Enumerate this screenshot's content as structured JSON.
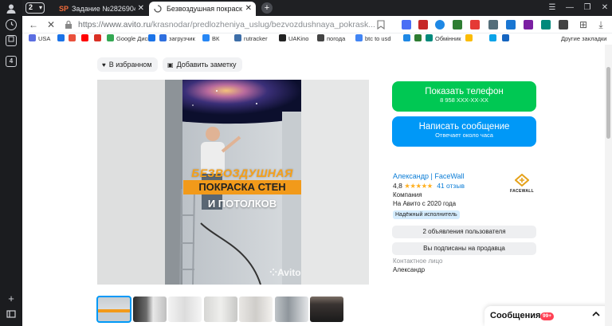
{
  "sidepanel": {
    "tab_count": "2",
    "shortcut_label": "4"
  },
  "tabs": [
    {
      "favicon": "SP",
      "title": "Задание №2826904 - пров"
    },
    {
      "favicon": "loading-icon",
      "title": "Безвоздушная покраск"
    }
  ],
  "address_bar": {
    "url_host": "https://www.avito.ru",
    "url_path": "/krasnodar/predlozheniya_uslug/bezvozdushnaya_pokrask..."
  },
  "bookmarks": [
    {
      "label": "USA",
      "color": "#5b6ee1"
    },
    {
      "label": "",
      "color": "#1a73e8"
    },
    {
      "label": "",
      "color": "#e9503c"
    },
    {
      "label": "",
      "color": "#ff0000"
    },
    {
      "label": "",
      "color": "#d93025"
    },
    {
      "label": "Google Диск",
      "color": "#34a853"
    },
    {
      "label": "",
      "color": "#1a73e8"
    },
    {
      "label": "загрузчик",
      "color": "#2f6fdf"
    },
    {
      "label": "ВК",
      "color": "#2787f5"
    },
    {
      "label": "rutracker",
      "color": "#3d6ea8"
    },
    {
      "label": "UAKino",
      "color": "#222"
    },
    {
      "label": "погода",
      "color": "#444"
    },
    {
      "label": "btc to usd",
      "color": "#4285f4"
    },
    {
      "label": "",
      "color": "#1e88e5"
    },
    {
      "label": "",
      "color": "#2e7d32"
    },
    {
      "label": "Обмінник",
      "color": "#00897b"
    },
    {
      "label": "",
      "color": "#fbbc05"
    },
    {
      "label": "",
      "color": "#0aa3e8"
    },
    {
      "label": "",
      "color": "#1565c0"
    },
    {
      "label": "Другие закладки",
      "color": ""
    }
  ],
  "actions": {
    "favorite": "В избранном",
    "note": "Добавить заметку"
  },
  "gallery": {
    "title_line1": "БЕЗВОЗДУШНАЯ",
    "title_line2": "ПОКРАСКА СТЕН",
    "title_line3": "И ПОТОЛКОВ",
    "watermark": "Avito",
    "thumb_count": 7
  },
  "contact": {
    "show_phone": "Показать телефон",
    "phone_mask": "8 958 XXX-XX-XX",
    "write_message": "Написать сообщение",
    "reply_time": "Отвечает около часа"
  },
  "seller": {
    "name": "Александр | FaceWall",
    "rating": "4,8",
    "stars": "★★★★★",
    "reviews": "41 отзыв",
    "type": "Компания",
    "since": "На Авито с 2020 года",
    "badge": "Надёжный исполнитель",
    "logo_text": "FACEWALL",
    "other_ads": "2 объявления пользователя",
    "subscribed": "Вы подписаны на продавца",
    "contact_label": "Контактное лицо",
    "contact_name": "Александр"
  },
  "messages": {
    "title": "Сообщения",
    "badge": "99+"
  },
  "colors": {
    "green_button": "#00c853",
    "blue_button": "#0098f7",
    "link": "#0a7cd6",
    "badge_bg": "#d5ecfe"
  }
}
